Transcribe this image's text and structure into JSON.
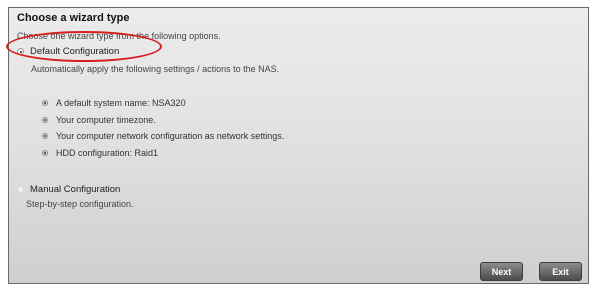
{
  "header": {
    "title": "Choose a wizard type",
    "subtitle": "Choose one wizard type from the following options."
  },
  "options": {
    "default": {
      "label": "Default Configuration",
      "description": "Automatically apply the following settings / actions to the NAS.",
      "selected": true,
      "items": [
        "A default system name: NSA320",
        "Your computer timezone.",
        "Your computer network configuration as network settings.",
        "HDD configuration: Raid1"
      ]
    },
    "manual": {
      "label": "Manual Configuration",
      "description": "Step-by-step configuration.",
      "selected": false
    }
  },
  "buttons": {
    "next": "Next",
    "exit": "Exit"
  },
  "colors": {
    "highlight": "#d41f1f",
    "button": "#5a5a5a"
  }
}
